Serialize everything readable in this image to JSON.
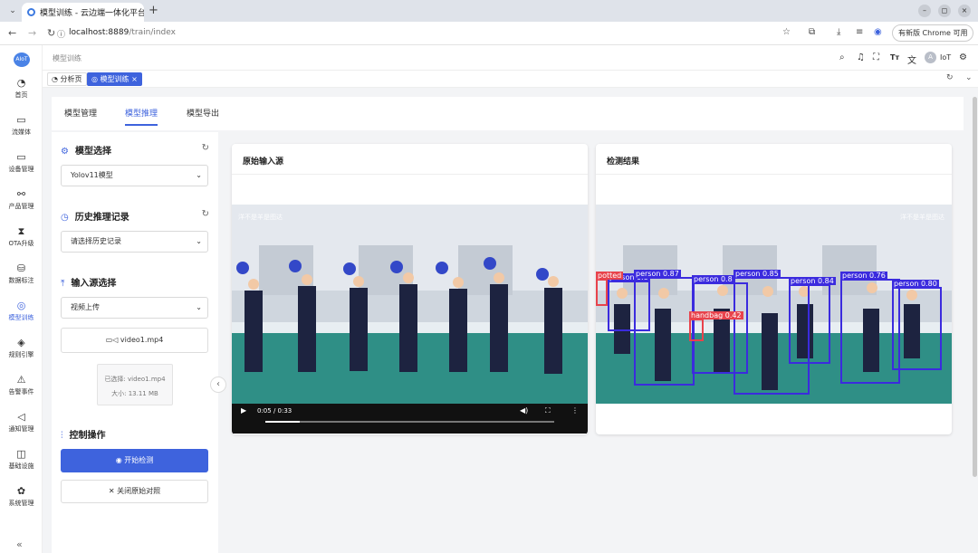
{
  "browser": {
    "tab_title": "模型训练 - 云边端一体化平台",
    "url_host": "localhost:8889",
    "url_path": "/train/index",
    "update_label": "有新版 Chrome 可用"
  },
  "sidebar": {
    "logo": "AIoT",
    "items": [
      {
        "label": "首页",
        "icon": "◔"
      },
      {
        "label": "流媒体",
        "icon": "▭"
      },
      {
        "label": "设备管理",
        "icon": "▭"
      },
      {
        "label": "产品管理",
        "icon": "⚯"
      },
      {
        "label": "OTA升级",
        "icon": "⧗"
      },
      {
        "label": "数据标注",
        "icon": "⛁"
      },
      {
        "label": "模型训练",
        "icon": "◎"
      },
      {
        "label": "规则引擎",
        "icon": "◈"
      },
      {
        "label": "告警事件",
        "icon": "⚠"
      },
      {
        "label": "通知管理",
        "icon": "◁"
      },
      {
        "label": "基础设施",
        "icon": "◫"
      },
      {
        "label": "系统管理",
        "icon": "✿"
      }
    ],
    "collapse": "«"
  },
  "header": {
    "breadcrumb": "模型训练",
    "user": "IoT",
    "avatar": "A"
  },
  "page_tabs": [
    {
      "label": "分析页"
    },
    {
      "label": "模型训练"
    }
  ],
  "main_tabs": [
    {
      "label": "模型管理"
    },
    {
      "label": "模型推理"
    },
    {
      "label": "模型导出"
    }
  ],
  "left_panel": {
    "model_section": "模型选择",
    "model_value": "Yolov11模型",
    "history_section": "历史推理记录",
    "history_placeholder": "请选择历史记录",
    "input_section": "输入源选择",
    "input_value": "视频上传",
    "file_button": "video1.mp4",
    "file_selected": "已选择: video1.mp4",
    "file_size": "大小: 13.11 MB",
    "control_section": "控制操作",
    "start_button": "开始检测",
    "close_button": "关闭原始对照"
  },
  "source_panel": {
    "title": "原始输入源",
    "watermark": "洋不是羊是图达",
    "time": "0:05 / 0:33",
    "progress": 0.12
  },
  "result_panel": {
    "title": "检测结果",
    "watermark": "洋不是羊是图达",
    "detections": [
      {
        "label": "person 0.87"
      },
      {
        "label": "person 0.85"
      },
      {
        "label": "person 0.8"
      },
      {
        "label": "person 0.84"
      },
      {
        "label": "person 0.76"
      },
      {
        "label": "person 0.80"
      },
      {
        "label": "handbag 0.42"
      },
      {
        "label": "person 0.8"
      },
      {
        "label": "potted"
      }
    ]
  },
  "colors": {
    "primary": "#3e63dd",
    "detection": "#3b2bde",
    "handbag": "#e8434c"
  }
}
